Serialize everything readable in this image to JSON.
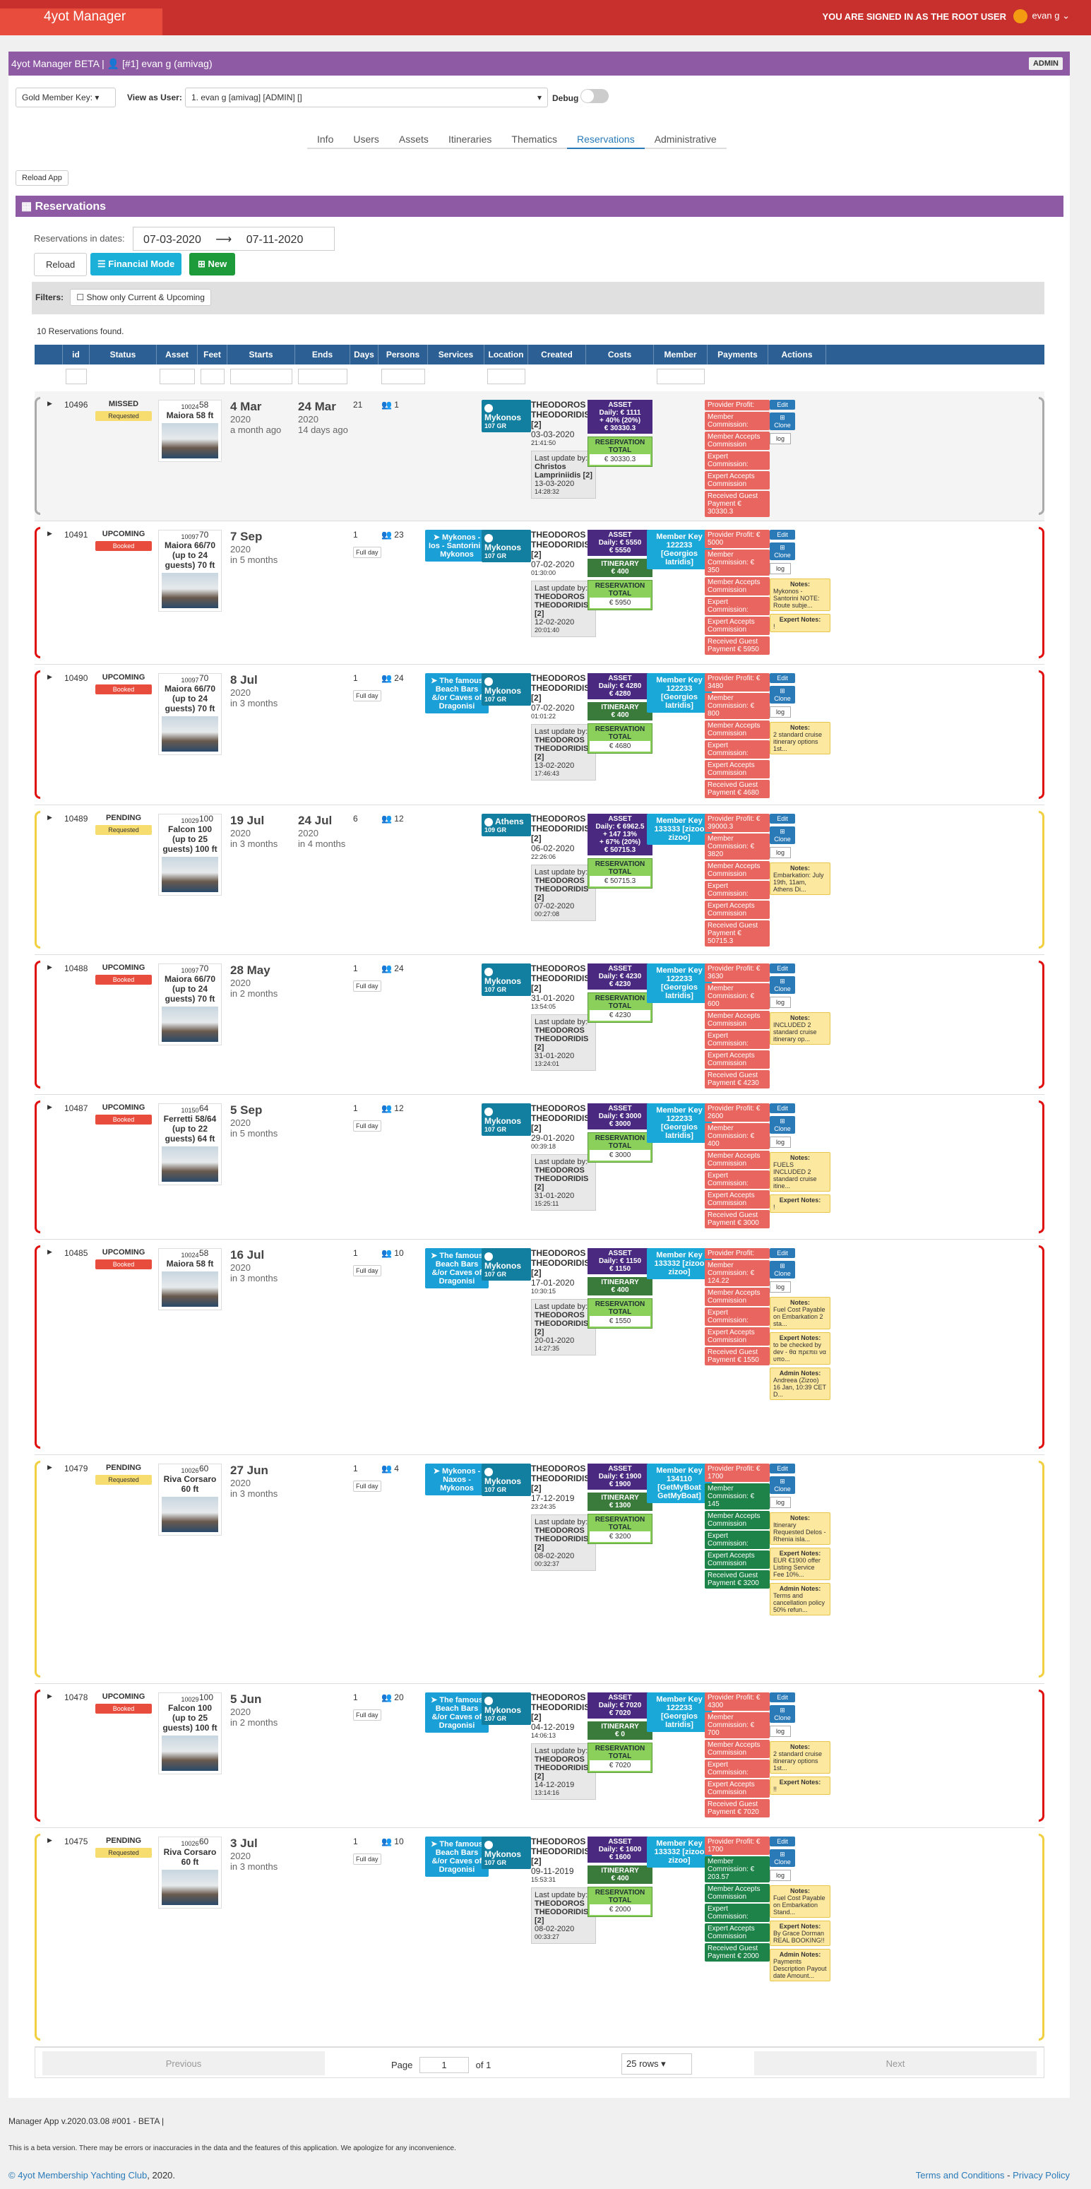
{
  "top": {
    "brand": "4yot Manager",
    "signed": "YOU ARE SIGNED IN AS THE ROOT USER",
    "user": "evan g ⌄"
  },
  "header": {
    "title": "4yot Manager BETA | 👤 [#1] evan g (amivag)",
    "badge": "ADMIN"
  },
  "controls": {
    "gold": "Gold Member Key: ▾",
    "view_as": "View as User:",
    "user_select": "1. evan g [amivag] [ADMIN] []",
    "debug": "Debug"
  },
  "tabs": [
    {
      "label": "Info"
    },
    {
      "label": "Users"
    },
    {
      "label": "Assets"
    },
    {
      "label": "Itineraries"
    },
    {
      "label": "Thematics"
    },
    {
      "label": "Reservations"
    },
    {
      "label": "Administrative"
    }
  ],
  "reload_app": "Reload App",
  "section_title": "Reservations",
  "dates": {
    "label": "Reservations in dates:",
    "from": "07-03-2020",
    "arrow": "⟶",
    "to": "07-11-2020"
  },
  "buttons": {
    "reload": "Reload",
    "financial": "Financial Mode",
    "new": "New"
  },
  "filters": {
    "label": "Filters:",
    "current": "Show only Current & Upcoming"
  },
  "found": "10 Reservations found.",
  "columns": [
    "",
    "id",
    "Status",
    "Asset",
    "Feet",
    "Starts",
    "Ends",
    "Days",
    "Persons",
    "Services",
    "Location",
    "Created",
    "Costs",
    "Member",
    "Payments",
    "Actions"
  ],
  "rows": [
    {
      "id": "10496",
      "status": "MISSED",
      "badge": "Requested",
      "asset_id": "10024",
      "asset": "Maiora 58 ft",
      "feet": "58",
      "start": "4 Mar",
      "start_y": "2020",
      "start_rel": "a month ago",
      "end": "24 Mar",
      "end_y": "2020",
      "end_rel": "14 days ago",
      "days": "21",
      "persons": "1",
      "service": "",
      "loc": "Mykonos",
      "loc_c": "107 GR",
      "created_by": "THEODOROS THEODORIDIS [2]",
      "created_d": "03-03-2020",
      "created_t": "21:41:50",
      "upd_by": "Christos Lampriniidis [2]",
      "upd_d": "13-03-2020",
      "upd_t": "14:28:32",
      "cost_lines": [
        "Daily: € 1111",
        "+ 40% (20%)",
        "€ 30330.3"
      ],
      "itin": "",
      "total": "€ 30330.3",
      "member": "",
      "pay": [
        "Provider Profit:",
        "Member Commission:",
        "Member Accepts Commission",
        "Expert Commission:",
        "Expert Accepts Commission",
        "Received Guest Payment € 30330.3"
      ],
      "notes": []
    },
    {
      "id": "10491",
      "status": "UPCOMING",
      "badge": "Booked",
      "asset_id": "10097",
      "asset": "Maiora 66/70 (up to 24 guests) 70 ft",
      "feet": "70",
      "start": "7 Sep",
      "start_y": "2020",
      "start_rel": "in 5 months",
      "end": "",
      "end_y": "",
      "end_rel": "",
      "days": "1",
      "persons": "23",
      "service": "Mykonos - Ios - Santorini - Mykonos",
      "loc": "Mykonos",
      "loc_c": "107 GR",
      "created_by": "THEODOROS THEODORIDIS [2]",
      "created_d": "07-02-2020",
      "created_t": "01:30:00",
      "upd_by": "THEODOROS THEODORIDIS [2]",
      "upd_d": "12-02-2020",
      "upd_t": "20:01:40",
      "cost_lines": [
        "Daily: € 5550",
        "€ 5550"
      ],
      "itin": "€ 400",
      "total": "€ 5950",
      "member": "Member Key 122233 [Georgios Iatridis]",
      "pay": [
        "Provider Profit: € 5000",
        "Member Commission: € 350",
        "Member Accepts Commission",
        "Expert Commission:",
        "Expert Accepts Commission",
        "Received Guest Payment € 5950"
      ],
      "notes": [
        [
          "Notes:",
          "Mykonos - Santorini NOTE: Route subje..."
        ],
        [
          "Expert Notes:",
          "!"
        ]
      ]
    },
    {
      "id": "10490",
      "status": "UPCOMING",
      "badge": "Booked",
      "asset_id": "10097",
      "asset": "Maiora 66/70 (up to 24 guests) 70 ft",
      "feet": "70",
      "start": "8 Jul",
      "start_y": "2020",
      "start_rel": "in 3 months",
      "end": "",
      "end_y": "",
      "end_rel": "",
      "days": "1",
      "persons": "24",
      "service": "The famous Beach Bars &/or Caves of Dragonisi",
      "loc": "Mykonos",
      "loc_c": "107 GR",
      "created_by": "THEODOROS THEODORIDIS [2]",
      "created_d": "07-02-2020",
      "created_t": "01:01:22",
      "upd_by": "THEODOROS THEODORIDIS [2]",
      "upd_d": "13-02-2020",
      "upd_t": "17:46:43",
      "cost_lines": [
        "Daily: € 4280",
        "€ 4280"
      ],
      "itin": "€ 400",
      "total": "€ 4680",
      "member": "Member Key 122233 [Georgios Iatridis]",
      "pay": [
        "Provider Profit: € 3480",
        "Member Commission: € 800",
        "Member Accepts Commission",
        "Expert Commission:",
        "Expert Accepts Commission",
        "Received Guest Payment € 4680"
      ],
      "notes": [
        [
          "Notes:",
          "2 standard cruise itinerary options 1st..."
        ]
      ]
    },
    {
      "id": "10489",
      "status": "PENDING",
      "badge": "Requested",
      "asset_id": "10029",
      "asset": "Falcon 100 (up to 25 guests) 100 ft",
      "feet": "100",
      "start": "19 Jul",
      "start_y": "2020",
      "start_rel": "in 3 months",
      "end": "24 Jul",
      "end_y": "2020",
      "end_rel": "in 4 months",
      "days": "6",
      "persons": "12",
      "service": "",
      "loc": "Athens",
      "loc_c": "109 GR",
      "created_by": "THEODOROS THEODORIDIS [2]",
      "created_d": "06-02-2020",
      "created_t": "22:26:06",
      "upd_by": "THEODOROS THEODORIDIS [2]",
      "upd_d": "07-02-2020",
      "upd_t": "00:27:08",
      "cost_lines": [
        "Daily: € 6962.5",
        "+ 147 13%",
        "+ 67% (20%)",
        "€ 50715.3"
      ],
      "itin": "",
      "total": "€ 50715.3",
      "member": "Member Key 133333 [zizoo zizoo]",
      "pay": [
        "Provider Profit: € 39000.3",
        "Member Commission: € 3820",
        "Member Accepts Commission",
        "Expert Commission:",
        "Expert Accepts Commission",
        "Received Guest Payment € 50715.3"
      ],
      "notes": [
        [
          "Notes:",
          "Embarkation: July 19th, 11am, Athens Di..."
        ]
      ]
    },
    {
      "id": "10488",
      "status": "UPCOMING",
      "badge": "Booked",
      "asset_id": "10097",
      "asset": "Maiora 66/70 (up to 24 guests) 70 ft",
      "feet": "70",
      "start": "28 May",
      "start_y": "2020",
      "start_rel": "in 2 months",
      "end": "",
      "end_y": "",
      "end_rel": "",
      "days": "1",
      "persons": "24",
      "service": "",
      "loc": "Mykonos",
      "loc_c": "107 GR",
      "created_by": "THEODOROS THEODORIDIS [2]",
      "created_d": "31-01-2020",
      "created_t": "13:54:05",
      "upd_by": "THEODOROS THEODORIDIS [2]",
      "upd_d": "31-01-2020",
      "upd_t": "13:24:01",
      "cost_lines": [
        "Daily: € 4230",
        "€ 4230"
      ],
      "itin": "",
      "total": "€ 4230",
      "member": "Member Key 122233 [Georgios Iatridis]",
      "pay": [
        "Provider Profit: € 3630",
        "Member Commission: € 600",
        "Member Accepts Commission",
        "Expert Commission:",
        "Expert Accepts Commission",
        "Received Guest Payment € 4230"
      ],
      "notes": [
        [
          "Notes:",
          "INCLUDED 2 standard cruise itinerary op..."
        ]
      ]
    },
    {
      "id": "10487",
      "status": "UPCOMING",
      "badge": "Booked",
      "asset_id": "10150",
      "asset": "Ferretti 58/64 (up to 22 guests) 64 ft",
      "feet": "64",
      "start": "5 Sep",
      "start_y": "2020",
      "start_rel": "in 5 months",
      "end": "",
      "end_y": "",
      "end_rel": "",
      "days": "1",
      "persons": "12",
      "service": "",
      "loc": "Mykonos",
      "loc_c": "107 GR",
      "created_by": "THEODOROS THEODORIDIS [2]",
      "created_d": "29-01-2020",
      "created_t": "00:39:18",
      "upd_by": "THEODOROS THEODORIDIS [2]",
      "upd_d": "31-01-2020",
      "upd_t": "15:25:11",
      "cost_lines": [
        "Daily: € 3000",
        "€ 3000"
      ],
      "itin": "",
      "total": "€ 3000",
      "member": "Member Key 122233 [Georgios Iatridis]",
      "pay": [
        "Provider Profit: € 2600",
        "Member Commission: € 400",
        "Member Accepts Commission",
        "Expert Commission:",
        "Expert Accepts Commission",
        "Received Guest Payment € 3000"
      ],
      "notes": [
        [
          "Notes:",
          "FUELS INCLUDED 2 standard cruise itine..."
        ],
        [
          "Expert Notes:",
          "!"
        ]
      ]
    },
    {
      "id": "10485",
      "status": "UPCOMING",
      "badge": "Booked",
      "asset_id": "10024",
      "asset": "Maiora 58 ft",
      "feet": "58",
      "start": "16 Jul",
      "start_y": "2020",
      "start_rel": "in 3 months",
      "end": "",
      "end_y": "",
      "end_rel": "",
      "days": "1",
      "persons": "10",
      "service": "The famous Beach Bars &/or Caves of Dragonisi",
      "loc": "Mykonos",
      "loc_c": "107 GR",
      "created_by": "THEODOROS THEODORIDIS [2]",
      "created_d": "17-01-2020",
      "created_t": "10:30:15",
      "upd_by": "THEODOROS THEODORIDIS [2]",
      "upd_d": "20-01-2020",
      "upd_t": "14:27:35",
      "cost_lines": [
        "Daily: € 1150",
        "€ 1150"
      ],
      "itin": "€ 400",
      "total": "€ 1550",
      "member": "Member Key 133332 [zizoo zizoo]",
      "pay": [
        "Provider Profit:",
        "Member Commission: € 124.22",
        "Member Accepts Commission",
        "Expert Commission:",
        "Expert Accepts Commission",
        "Received Guest Payment € 1550"
      ],
      "notes": [
        [
          "Notes:",
          "Fuel Cost Payable on Embarkation 2 sta..."
        ],
        [
          "Expert Notes:",
          "to be checked by dev - θα πρεπει να υπο..."
        ],
        [
          "Admin Notes:",
          "Andreea (Zizoo) 16 Jan, 10:39 CET D..."
        ]
      ]
    },
    {
      "id": "10479",
      "status": "PENDING",
      "badge": "Requested",
      "asset_id": "10026",
      "asset": "Riva Corsaro 60 ft",
      "feet": "60",
      "start": "27 Jun",
      "start_y": "2020",
      "start_rel": "in 3 months",
      "end": "",
      "end_y": "",
      "end_rel": "",
      "days": "1",
      "persons": "4",
      "service": "Mykonos - Naxos - Mykonos",
      "loc": "Mykonos",
      "loc_c": "107 GR",
      "created_by": "THEODOROS THEODORIDIS [2]",
      "created_d": "17-12-2019",
      "created_t": "23:24:35",
      "upd_by": "THEODOROS THEODORIDIS [2]",
      "upd_d": "08-02-2020",
      "upd_t": "00:32:37",
      "cost_lines": [
        "Daily: € 1900",
        "€ 1900"
      ],
      "itin": "€ 1300",
      "total": "€ 3200",
      "member": "Member Key 134110 [GetMyBoat GetMyBoat]",
      "pay": [
        "Provider Profit: € 1700",
        "Member Commission: € 145",
        "Member Accepts Commission",
        "Expert Commission:",
        "Expert Accepts Commission",
        "Received Guest Payment € 3200"
      ],
      "paygreen": true,
      "notes": [
        [
          "Notes:",
          "Itinerary Requested Delos -Rhenia isla..."
        ],
        [
          "Expert Notes:",
          "EUR €1900 offer Listing Service Fee 10%..."
        ],
        [
          "Admin Notes:",
          "Terms and cancellation policy 50% refun..."
        ]
      ]
    },
    {
      "id": "10478",
      "status": "UPCOMING",
      "badge": "Booked",
      "asset_id": "10029",
      "asset": "Falcon 100 (up to 25 guests) 100 ft",
      "feet": "100",
      "start": "5 Jun",
      "start_y": "2020",
      "start_rel": "in 2 months",
      "end": "",
      "end_y": "",
      "end_rel": "",
      "days": "1",
      "persons": "20",
      "service": "The famous Beach Bars &/or Caves of Dragonisi",
      "loc": "Mykonos",
      "loc_c": "107 GR",
      "created_by": "THEODOROS THEODORIDIS [2]",
      "created_d": "04-12-2019",
      "created_t": "14:06:13",
      "upd_by": "THEODOROS THEODORIDIS [2]",
      "upd_d": "14-12-2019",
      "upd_t": "13:14:16",
      "cost_lines": [
        "Daily: € 7020",
        "€ 7020"
      ],
      "itin": "€ 0",
      "total": "€ 7020",
      "member": "Member Key 122233 [Georgios Iatridis]",
      "pay": [
        "Provider Profit: € 4300",
        "Member Commission: € 700",
        "Member Accepts Commission",
        "Expert Commission:",
        "Expert Accepts Commission",
        "Received Guest Payment € 7020"
      ],
      "notes": [
        [
          "Notes:",
          "2 standard cruise itinerary options 1st..."
        ],
        [
          "Expert Notes:",
          "!!"
        ]
      ]
    },
    {
      "id": "10475",
      "status": "PENDING",
      "badge": "Requested",
      "asset_id": "10026",
      "asset": "Riva Corsaro 60 ft",
      "feet": "60",
      "start": "3 Jul",
      "start_y": "2020",
      "start_rel": "in 3 months",
      "end": "",
      "end_y": "",
      "end_rel": "",
      "days": "1",
      "persons": "10",
      "service": "The famous Beach Bars &/or Caves of Dragonisi",
      "loc": "Mykonos",
      "loc_c": "107 GR",
      "created_by": "THEODOROS THEODORIDIS [2]",
      "created_d": "09-11-2019",
      "created_t": "15:53:31",
      "upd_by": "THEODOROS THEODORIDIS [2]",
      "upd_d": "08-02-2020",
      "upd_t": "00:33:27",
      "cost_lines": [
        "Daily: € 1600",
        "€ 1600"
      ],
      "itin": "€ 400",
      "total": "€ 2000",
      "member": "Member Key 133332 [zizoo zizoo]",
      "pay": [
        "Provider Profit: € 1700",
        "Member Commission: € 203.57",
        "Member Accepts Commission",
        "Expert Commission:",
        "Expert Accepts Commission",
        "Received Guest Payment € 2000"
      ],
      "paygreen": true,
      "notes": [
        [
          "Notes:",
          "Fuel Cost Payable on Embarkation Stand..."
        ],
        [
          "Expert Notes:",
          "By Grace Dorman REAL BOOKING!!"
        ],
        [
          "Admin Notes:",
          "Payments Description Payout date Amount..."
        ]
      ]
    }
  ],
  "pager": {
    "prev": "Previous",
    "page": "Page",
    "page_num": "1",
    "of": "of 1",
    "rows": "25 rows",
    "next": "Next"
  },
  "footer": {
    "version": "Manager App v.2020.03.08 #001 - BETA |",
    "beta": "This is a beta version. There may be errors or inaccuracies in the data and the features of this application. We apologize for any inconvenience.",
    "copy_link": "© 4yot Membership Yachting Club",
    "copy_rest": ", 2020.",
    "terms": "Terms and Conditions",
    "privacy": "Privacy Policy"
  },
  "colors": {
    "missed": "#aaaaaa",
    "upcoming": "#e01010",
    "pending": "#f0d040"
  }
}
